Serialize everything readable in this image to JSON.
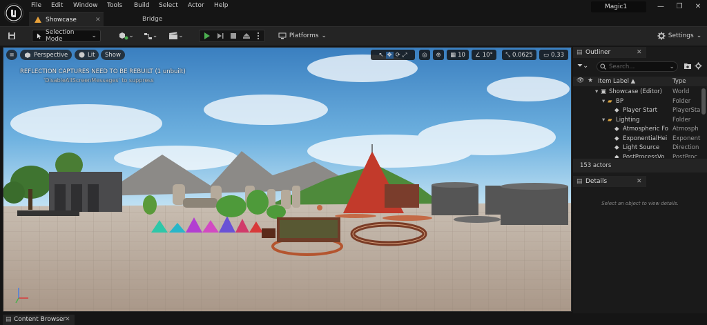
{
  "menu": [
    "File",
    "Edit",
    "Window",
    "Tools",
    "Build",
    "Select",
    "Actor",
    "Help"
  ],
  "tabs": [
    {
      "label": "Showcase",
      "active": true
    },
    {
      "label": "Bridge",
      "active": false
    }
  ],
  "project_name": "Magic1",
  "window_controls": {
    "minimize": "—",
    "restore": "❐",
    "close": "✕"
  },
  "toolbar": {
    "selection_mode": "Selection Mode",
    "platforms": "Platforms",
    "settings": "Settings"
  },
  "viewport": {
    "view_mode": "Perspective",
    "lighting": "Lit",
    "show": "Show",
    "grid_size": "10",
    "rotation_snap": "10°",
    "scale_snap": "0.0625",
    "camera_speed": "0.33",
    "warning": "REFLECTION CAPTURES NEED TO BE REBUILT (1 unbuilt)",
    "warning_hint": "'DisableAllScreenMessages' to suppress"
  },
  "outliner": {
    "title": "Outliner",
    "search_placeholder": "Search...",
    "col_label": "Item Label ▲",
    "col_type": "Type",
    "rows": [
      {
        "label": "Showcase (Editor)",
        "type": "World",
        "indent": 1,
        "icon": "world"
      },
      {
        "label": "BP",
        "type": "Folder",
        "indent": 2,
        "icon": "folder"
      },
      {
        "label": "Player Start",
        "type": "PlayerSta",
        "indent": 3,
        "icon": "actor"
      },
      {
        "label": "Lighting",
        "type": "Folder",
        "indent": 2,
        "icon": "folder"
      },
      {
        "label": "Atmospheric Fo",
        "type": "Atmosph",
        "indent": 3,
        "icon": "actor"
      },
      {
        "label": "ExponentialHei",
        "type": "Exponent",
        "indent": 3,
        "icon": "actor"
      },
      {
        "label": "Light Source",
        "type": "Direction",
        "indent": 3,
        "icon": "actor"
      },
      {
        "label": "PostProcessVo",
        "type": "PostProc",
        "indent": 3,
        "icon": "actor"
      }
    ],
    "actor_count": "153 actors"
  },
  "details": {
    "title": "Details",
    "empty_message": "Select an object to view details."
  },
  "bottom": {
    "content_browser": "Content Browser"
  },
  "colors": {
    "accent": "#e8a13a",
    "play": "#4caf50",
    "selection": "#2a5a8c"
  }
}
